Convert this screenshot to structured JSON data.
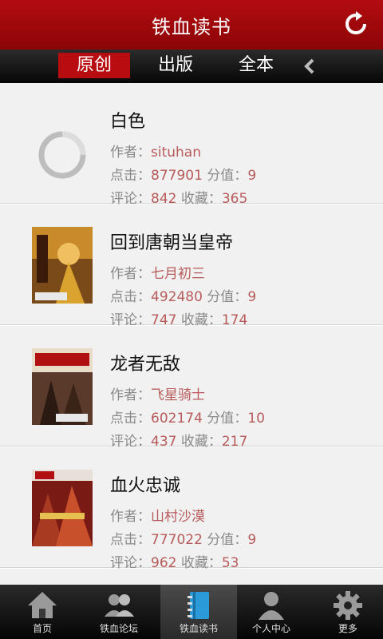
{
  "header": {
    "title": "铁血读书"
  },
  "tabs": [
    {
      "label": "原创"
    },
    {
      "label": "出版"
    },
    {
      "label": "全本"
    }
  ],
  "labels": {
    "author": "作者：",
    "clicks": "点击：",
    "score": "分值：",
    "comments": "评论：",
    "favorites": "收藏："
  },
  "books": [
    {
      "title": "白色",
      "author": "situhan",
      "clicks": "877901",
      "score": "9",
      "comments": "842",
      "favorites": "365"
    },
    {
      "title": "回到唐朝当皇帝",
      "author": "七月初三",
      "clicks": "492480",
      "score": "9",
      "comments": "747",
      "favorites": "174"
    },
    {
      "title": "龙者无敌",
      "author": "飞星骑士",
      "clicks": "602174",
      "score": "10",
      "comments": "437",
      "favorites": "217"
    },
    {
      "title": "血火忠诚",
      "author": "山村沙漠",
      "clicks": "777022",
      "score": "9",
      "comments": "962",
      "favorites": "53"
    }
  ],
  "bottom_nav": [
    {
      "label": "首页",
      "icon": "home-icon"
    },
    {
      "label": "铁血论坛",
      "icon": "forum-icon"
    },
    {
      "label": "铁血读书",
      "icon": "notebook-icon"
    },
    {
      "label": "个人中心",
      "icon": "person-icon"
    },
    {
      "label": "更多",
      "icon": "gear-icon"
    }
  ],
  "colors": {
    "header_red": "#b20c10",
    "tab_active": "#b80d10",
    "value_text": "#b85a5a"
  }
}
